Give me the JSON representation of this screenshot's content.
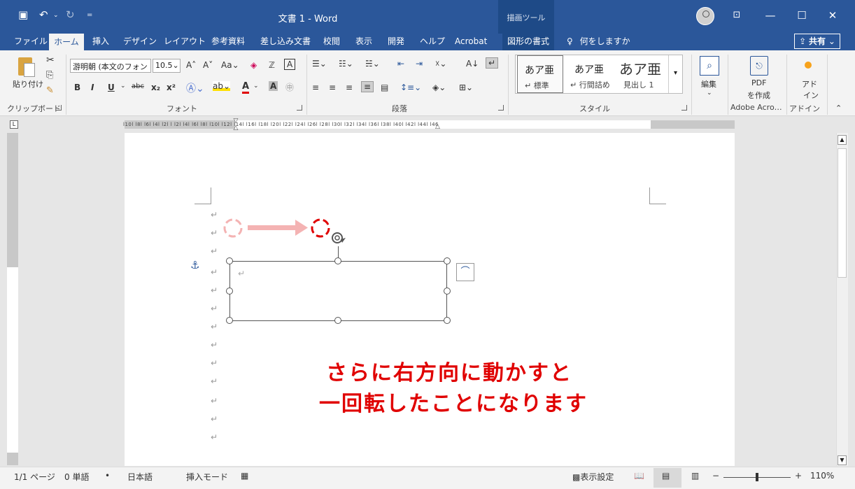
{
  "window": {
    "title": "文書 1  -  Word",
    "context_tool": "描画ツール",
    "quick_access_icons": [
      "save-icon",
      "undo-icon",
      "undo-dropdown-icon",
      "redo-icon",
      "customize-icon"
    ],
    "controls": {
      "ribbon_display": "⊡",
      "minimize": "—",
      "maximize": "☐",
      "close": "✕"
    }
  },
  "tabs": [
    {
      "label": "ファイル",
      "active": false
    },
    {
      "label": "ホーム",
      "active": true
    },
    {
      "label": "挿入",
      "active": false
    },
    {
      "label": "デザイン",
      "active": false
    },
    {
      "label": "レイアウト",
      "active": false
    },
    {
      "label": "参考資料",
      "active": false
    },
    {
      "label": "差し込み文書",
      "active": false
    },
    {
      "label": "校閲",
      "active": false
    },
    {
      "label": "表示",
      "active": false
    },
    {
      "label": "開発",
      "active": false
    },
    {
      "label": "ヘルプ",
      "active": false
    },
    {
      "label": "Acrobat",
      "active": false
    },
    {
      "label": "図形の書式",
      "active": false
    }
  ],
  "search": {
    "label": "何をしますか"
  },
  "share": {
    "label": "共有"
  },
  "ribbon": {
    "clipboard": {
      "paste": "貼り付け",
      "group": "クリップボード"
    },
    "font": {
      "name": "游明朝 (本文のフォン",
      "size": "10.5",
      "group": "フォント",
      "bold": "B",
      "italic": "I",
      "underline": "U",
      "strike": "abc",
      "sub": "x₂",
      "sup": "x²",
      "change_case": "Aa"
    },
    "paragraph": {
      "group": "段落"
    },
    "styles": {
      "group": "スタイル",
      "items": [
        {
          "preview": "あア亜",
          "name": "標準"
        },
        {
          "preview": "あア亜",
          "name": "行間詰め"
        },
        {
          "preview": "あア亜",
          "name": "見出し 1"
        }
      ]
    },
    "editing": {
      "label": "編集"
    },
    "pdf": {
      "label1": "PDF",
      "label2": "を作成",
      "group": "Adobe Acro…"
    },
    "addin": {
      "label1": "アド",
      "label2": "イン",
      "group": "アドイン"
    }
  },
  "ruler": {
    "numbers": "l10l l8l l6l l4l l2l  l  l2l l4l l6l l8l l10l l12l l14l l16l l18l l20l l22l l24l l26l l28l l30l l32l l34l l36l l38l l40l l42l l44l l46"
  },
  "document": {
    "paragraph_mark": "↵",
    "annotation_line1": "さらに右方向に動かすと",
    "annotation_line2": "一回転したことになります"
  },
  "status": {
    "page": "1/1 ページ",
    "words": "0 単語",
    "language": "日本語",
    "mode": "挿入モード",
    "display_settings": "表示設定",
    "zoom": "110%"
  },
  "colors": {
    "brand": "#2b579a",
    "annotation": "#e00000",
    "arrow": "#f4b3b3"
  }
}
